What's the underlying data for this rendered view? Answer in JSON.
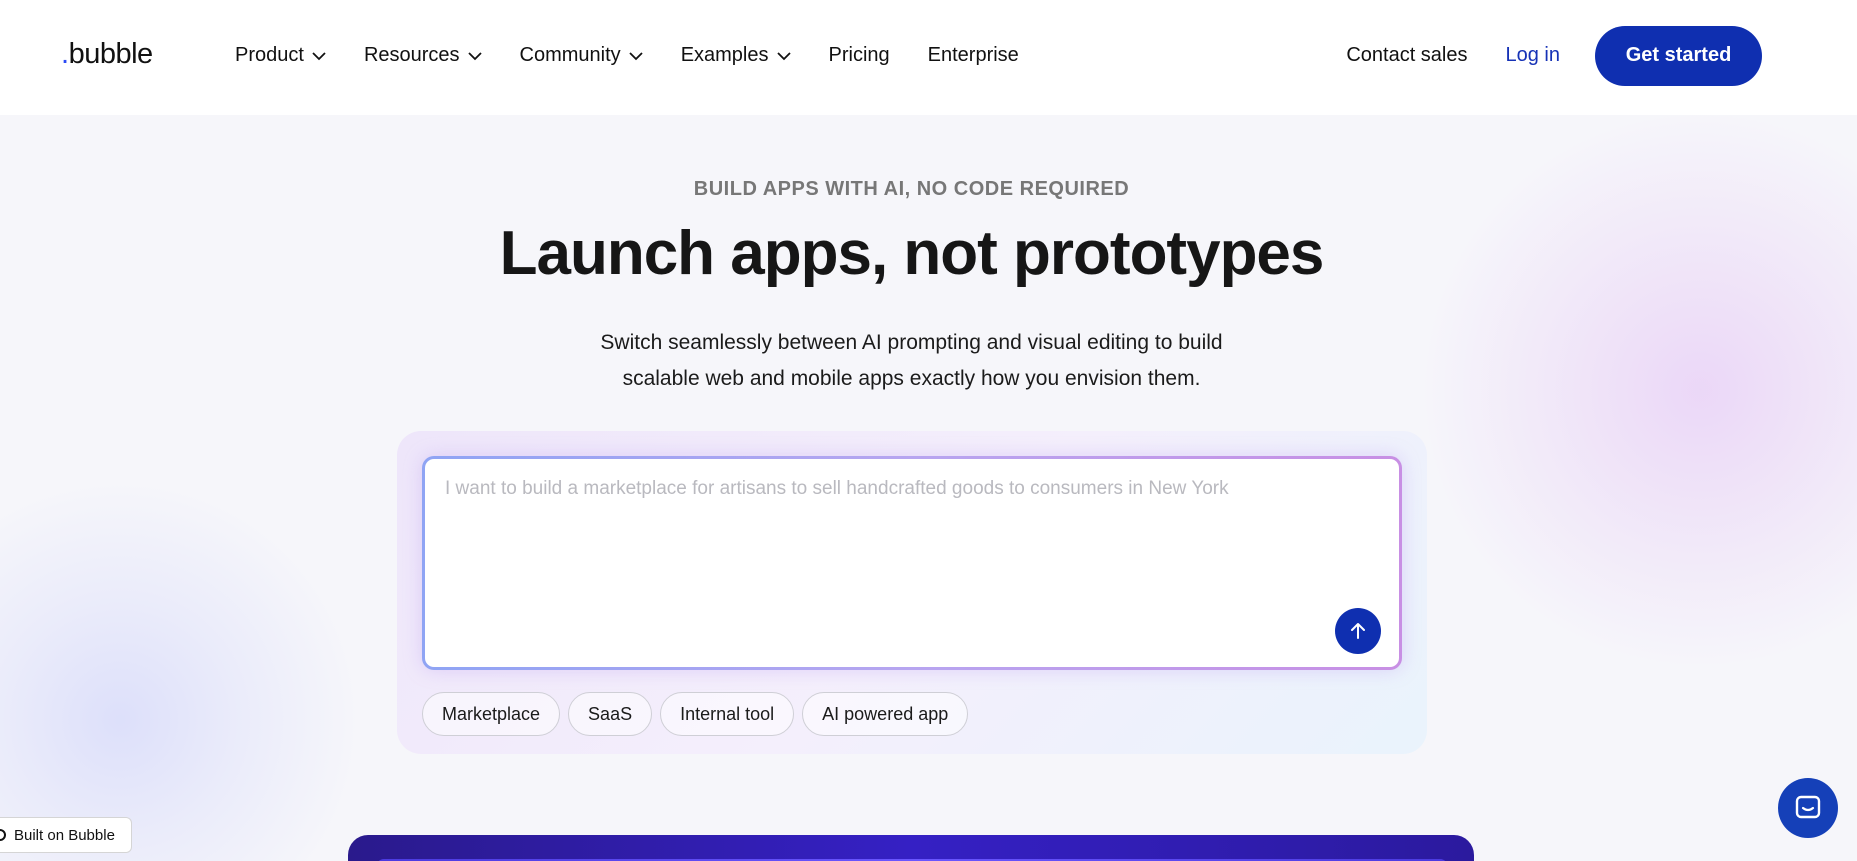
{
  "brand": {
    "logo_text": "bubble",
    "logo_dot": "."
  },
  "nav": {
    "items": [
      {
        "label": "Product",
        "dropdown": true
      },
      {
        "label": "Resources",
        "dropdown": true
      },
      {
        "label": "Community",
        "dropdown": true
      },
      {
        "label": "Examples",
        "dropdown": true
      },
      {
        "label": "Pricing",
        "dropdown": false
      },
      {
        "label": "Enterprise",
        "dropdown": false
      }
    ],
    "contact_sales": "Contact sales",
    "login": "Log in",
    "get_started": "Get started"
  },
  "hero": {
    "eyebrow": "BUILD APPS WITH AI, NO CODE REQUIRED",
    "headline": "Launch apps, not prototypes",
    "subtitle_line1": "Switch seamlessly between AI prompting and visual editing to build",
    "subtitle_line2": "scalable web and mobile apps exactly how you envision them."
  },
  "prompt": {
    "placeholder": "I want to build a marketplace for artisans to sell handcrafted goods to consumers in New York",
    "send_icon": "arrow-up-icon",
    "chips": [
      "Marketplace",
      "SaaS",
      "Internal tool",
      "AI powered app"
    ]
  },
  "footer_badge": {
    "label": "Built on Bubble"
  },
  "chat": {
    "icon": "chat-bubble-icon"
  },
  "colors": {
    "primary": "#0f2fb0",
    "login_link": "#1632b6",
    "background": "#f6f6fa",
    "eyebrow": "#777777"
  }
}
